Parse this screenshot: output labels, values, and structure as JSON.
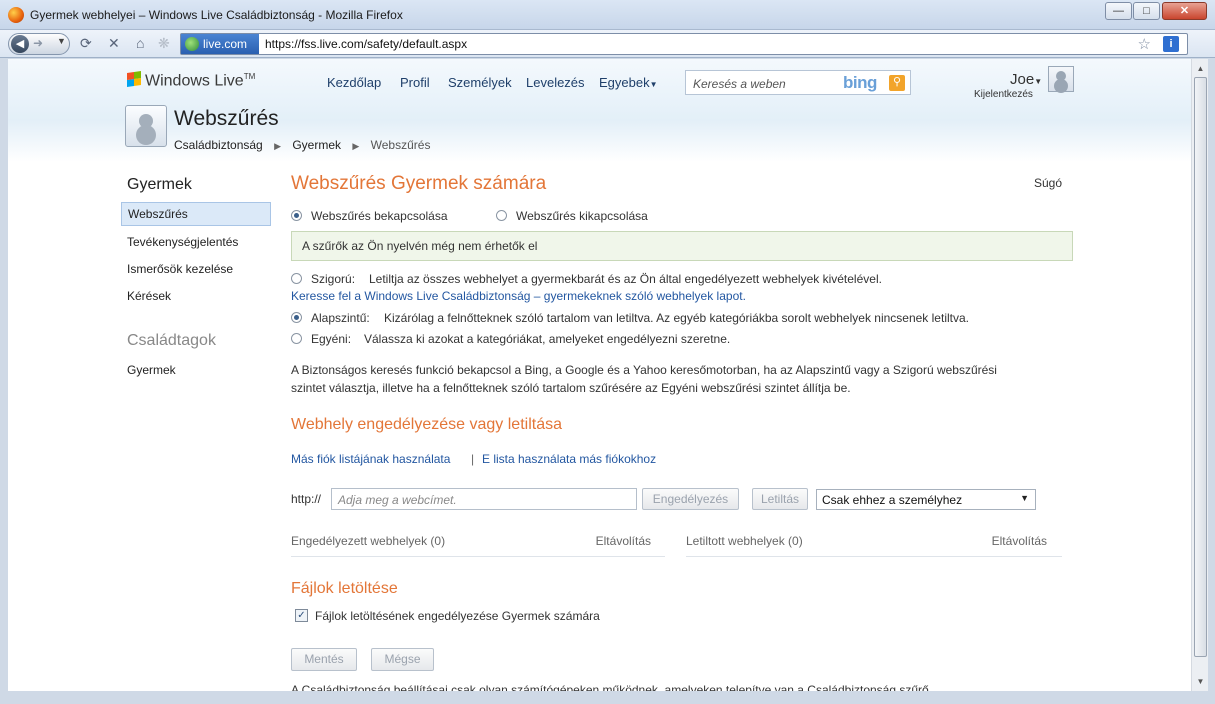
{
  "window": {
    "title": "Gyermek webhelyei – Windows Live Családbiztonság - Mozilla Firefox",
    "min_icon": "minimize-icon",
    "max_icon": "maximize-icon",
    "close_icon": "close-icon"
  },
  "browser": {
    "site_badge": "live.com",
    "url": "https://fss.live.com/safety/default.aspx"
  },
  "header": {
    "logo_text": "Windows Live",
    "logo_tm": "TM",
    "nav": [
      "Kezdőlap",
      "Profil",
      "Személyek",
      "Levelezés",
      "Egyebek"
    ],
    "search_placeholder": "Keresés a weben",
    "search_brand": "bing",
    "user_name": "Joe",
    "signout": "Kijelentkezés"
  },
  "page": {
    "title": "Webszűrés",
    "breadcrumb": [
      "Családbiztonság",
      "Gyermek",
      "Webszűrés"
    ]
  },
  "sidebar": {
    "section1_title": "Gyermek",
    "items": [
      "Webszűrés",
      "Tevékenységjelentés",
      "Ismerősök kezelése",
      "Kérések"
    ],
    "section2_title": "Családtagok",
    "members": [
      "Gyermek"
    ]
  },
  "main": {
    "heading": "Webszűrés Gyermek számára",
    "help": "Súgó",
    "radio_on": "Webszűrés bekapcsolása",
    "radio_off": "Webszűrés kikapcsolása",
    "notice": "A szűrők az Ön nyelvén még nem érhetők el",
    "levels": {
      "strict_label": "Szigorú:",
      "strict_desc": "Letiltja az összes webhelyet a gyermekbarát és az Ön által engedélyezett webhelyek kivételével.",
      "strict_link": "Keresse fel a Windows Live Családbiztonság – gyermekeknek szóló webhelyek lapot.",
      "basic_label": "Alapszintű:",
      "basic_desc": "Kizárólag a felnőtteknek szóló tartalom van letiltva. Az egyéb kategóriákba sorolt webhelyek nincsenek letiltva.",
      "custom_label": "Egyéni:",
      "custom_desc": "Válassza ki azokat a kategóriákat, amelyeket engedélyezni szeretne."
    },
    "safesearch_line1": "A Biztonságos keresés funkció bekapcsol a Bing, a Google és a Yahoo keresőmotorban, ha az Alapszintű vagy a Szigorú webszűrési",
    "safesearch_line2": "szintet választja, illetve ha a felnőtteknek szóló tartalom szűrésére az Egyéni webszűrési szintet állítja be.",
    "allow_block_heading": "Webhely engedélyezése vagy letiltása",
    "link_other_list": "Más fiók listájának használata",
    "link_separator": "|",
    "link_this_list": "E lista használata más fiókokhoz",
    "http_prefix": "http://",
    "url_placeholder": "Adja meg a webcímet.",
    "btn_allow": "Engedélyezés",
    "btn_block": "Letiltás",
    "scope_select": "Csak ehhez a személyhez",
    "allowed_header": "Engedélyezett webhelyek (0)",
    "allowed_remove": "Eltávolítás",
    "blocked_header": "Letiltott webhelyek (0)",
    "blocked_remove": "Eltávolítás",
    "downloads_heading": "Fájlok letöltése",
    "downloads_checkbox": "Fájlok letöltésének engedélyezése Gyermek számára",
    "btn_save": "Mentés",
    "btn_cancel": "Mégse",
    "footer_clipped": "A Családbiztonság beállításai csak olyan számítógépeken működnek, amelyeken telepítve van a Családbiztonság szűrő"
  }
}
